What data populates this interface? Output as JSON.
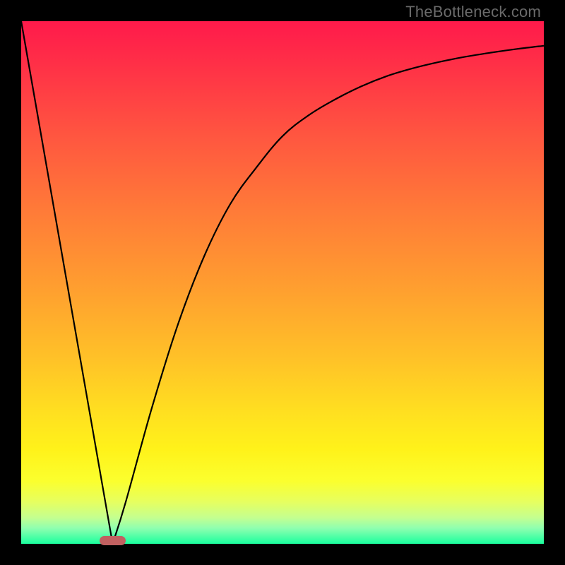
{
  "watermark": "TheBottleneck.com",
  "colors": {
    "frame": "#000000",
    "curve": "#000000",
    "marker": "#c16060",
    "gradient_stops": [
      "#ff1a4b",
      "#ff2f47",
      "#ff5640",
      "#ff7a38",
      "#ff9c30",
      "#ffc028",
      "#ffe020",
      "#fff21a",
      "#fbff2e",
      "#e6ff60",
      "#c4ff90",
      "#8fffb0",
      "#1aff9e"
    ]
  },
  "chart_data": {
    "type": "line",
    "title": "",
    "xlabel": "",
    "ylabel": "",
    "x_range": [
      0,
      100
    ],
    "y_range": [
      0,
      100
    ],
    "marker": {
      "x_center": 17.5,
      "y": 0,
      "width": 5
    },
    "curve_points": [
      {
        "x": 0,
        "y": 100
      },
      {
        "x": 17.5,
        "y": 0
      },
      {
        "x": 20,
        "y": 8
      },
      {
        "x": 25,
        "y": 26
      },
      {
        "x": 30,
        "y": 42
      },
      {
        "x": 35,
        "y": 55
      },
      {
        "x": 40,
        "y": 65
      },
      {
        "x": 45,
        "y": 72
      },
      {
        "x": 50,
        "y": 78
      },
      {
        "x": 55,
        "y": 82
      },
      {
        "x": 60,
        "y": 85
      },
      {
        "x": 65,
        "y": 87.5
      },
      {
        "x": 70,
        "y": 89.5
      },
      {
        "x": 75,
        "y": 91
      },
      {
        "x": 80,
        "y": 92.2
      },
      {
        "x": 85,
        "y": 93.2
      },
      {
        "x": 90,
        "y": 94
      },
      {
        "x": 95,
        "y": 94.7
      },
      {
        "x": 100,
        "y": 95.3
      }
    ]
  }
}
